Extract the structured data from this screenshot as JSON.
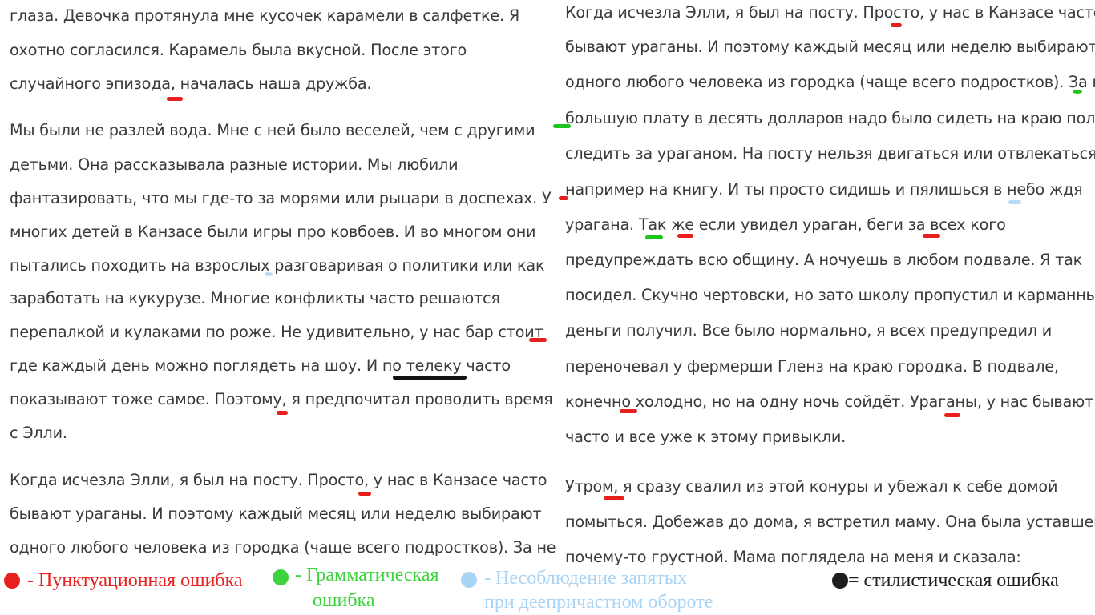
{
  "left_lines": [
    "глаза. Девочка протянула мне кусочек карамели в салфетке. Я",
    "охотно согласился. Карамель была вкусной. После этого",
    "случайного эпизода, началась наша дружба.",
    "Мы были не разлей вода. Мне с ней было веселей, чем с другими",
    "детьми. Она рассказывала разные истории. Мы любили",
    "фантазировать, что мы где-то за морями или рыцари в доспехах. У",
    "многих детей в Канзасе были игры про ковбоев. И во многом они",
    "пытались походить на взрослых разговаривая о политики или как",
    "заработать на кукурузе.  Многие конфликты часто решаются",
    "перепалкой и кулаками по роже. Не удивительно, у нас бар стоит",
    "где каждый день можно поглядеть на шоу. И по телеку часто",
    "показывают тоже самое. Поэтому, я предпочитал проводить время",
    "с Элли.",
    "Когда исчезла Элли, я был на посту. Просто, у нас в Канзасе часто",
    "бывают ураганы. И поэтому каждый месяц или неделю выбирают",
    "одного любого человека из городка (чаще всего подростков). За не"
  ],
  "right_lines": [
    "Когда исчезла Элли, я был на посту. Просто, у нас в Канзасе часто",
    "бывают ураганы. И поэтому каждый месяц или неделю выбирают",
    "одного любого человека из городка (чаще всего подростков). За не",
    "большую плату в десять долларов надо было сидеть на краю поля и",
    "следить за ураганом. На посту нельзя двигаться или отвлекаться",
    "например на книгу. И ты просто сидишь и пялишься в небо ждя",
    "урагана. Так же если увидел ураган, беги за всех кого",
    "предупреждать всю общину. А ночуешь в любом подвале. Я так",
    "посидел. Скучно чертовски, но зато школу пропустил и карманные",
    "деньги получил. Все было нормально, я всех предупредил и",
    "переночевал у фермерши Гленз на краю городка. В подвале,",
    "конечно холодно, но на одну ночь сойдёт. Ураганы, у нас бывают",
    "часто и все уже к этому привыкли.",
    "Утром, я сразу свалил из этой конуры и убежал к себе домой",
    "помыться. Добежав до дома, я встретил маму. Она была уставшей и",
    "почему-то грустной. Мама поглядела на меня и сказала:"
  ],
  "legend": {
    "punctuation": {
      "label": "- Пунктуационная ошибка",
      "color": "#e8201d"
    },
    "grammar": {
      "label_line1": "- Грамматическая",
      "label_line2": "ошибка",
      "color": "#3cd33c"
    },
    "participle": {
      "label_line1": "- Несоблюдение запятых",
      "label_line2": "при деепричастном обороте",
      "color": "#a8d4f5"
    },
    "stylistic": {
      "label": "= стилистическая ошибка",
      "color": "#1e1e1e"
    }
  }
}
